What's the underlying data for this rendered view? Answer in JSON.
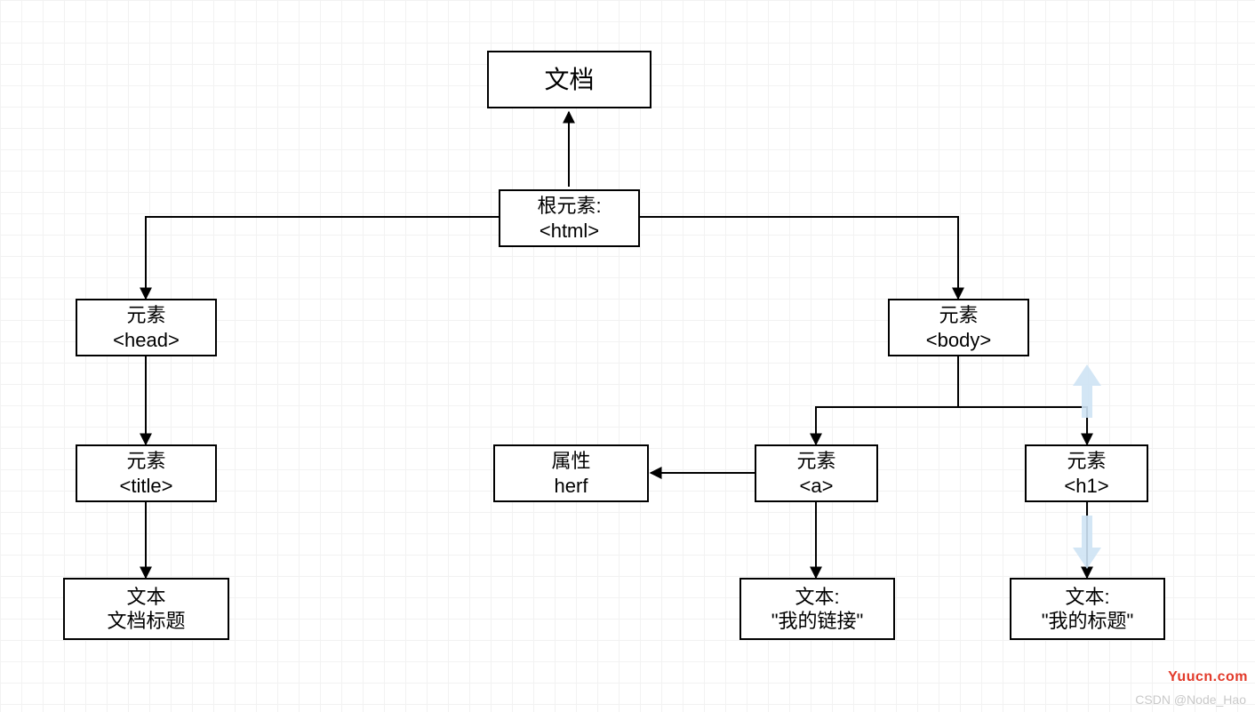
{
  "nodes": {
    "doc": {
      "line1": "文档",
      "line2": ""
    },
    "html": {
      "line1": "根元素:",
      "line2": "<html>"
    },
    "head": {
      "line1": "元素",
      "line2": "<head>"
    },
    "body": {
      "line1": "元素",
      "line2": "<body>"
    },
    "title": {
      "line1": "元素",
      "line2": "<title>"
    },
    "attrHerf": {
      "line1": "属性",
      "line2": "herf"
    },
    "a": {
      "line1": "元素",
      "line2": "<a>"
    },
    "h1": {
      "line1": "元素",
      "line2": "<h1>"
    },
    "textTitle": {
      "line1": "文本",
      "line2": "文档标题"
    },
    "textLink": {
      "line1": "文本:",
      "line2": "\"我的链接\""
    },
    "textH1": {
      "line1": "文本:",
      "line2": "\"我的标题\""
    }
  },
  "watermarks": {
    "right": "Yuucn.com",
    "bottom": "CSDN @Node_Hao"
  }
}
